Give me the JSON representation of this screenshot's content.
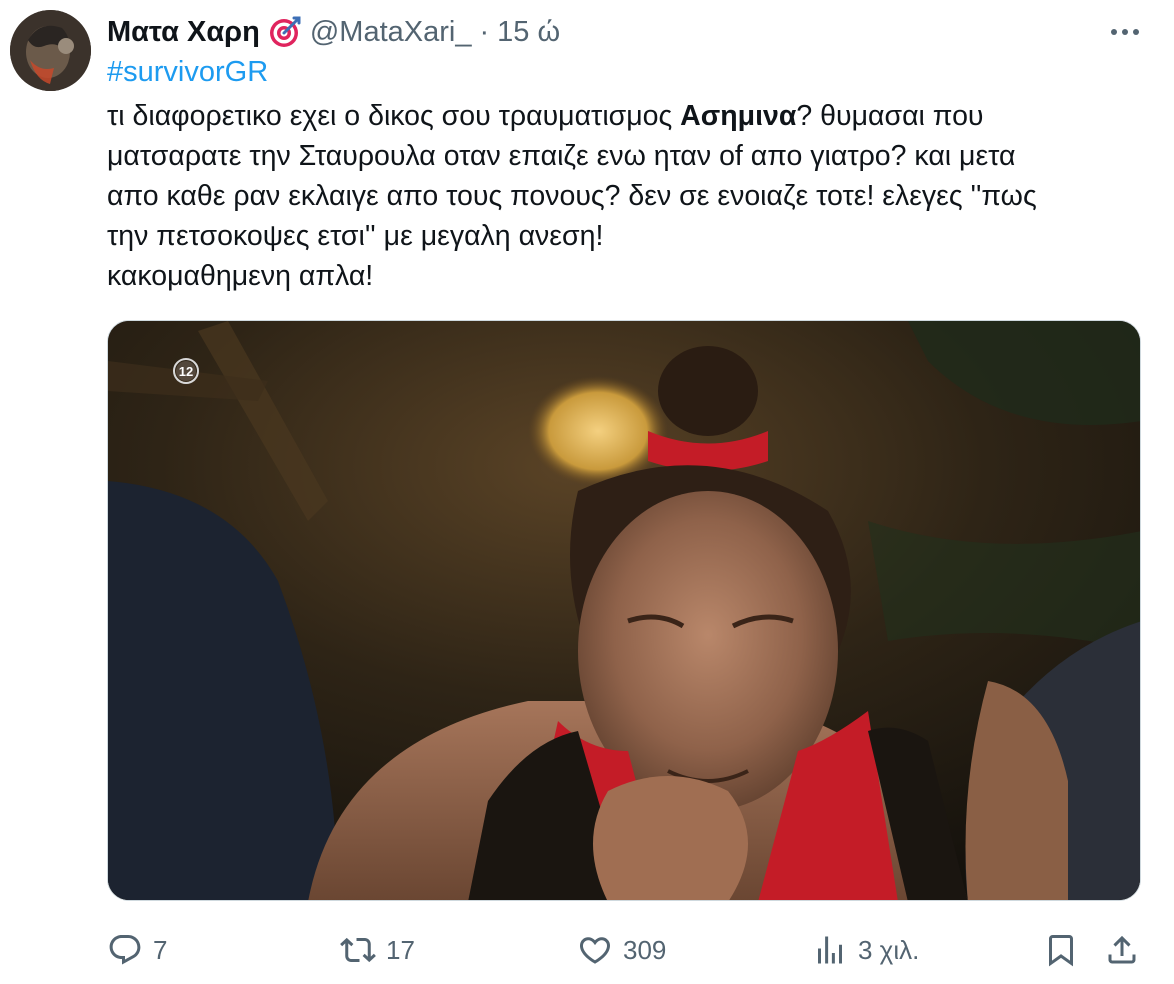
{
  "author": {
    "display_name": "Ματα Χαρη",
    "badge_icon": "target-icon",
    "handle": "@MataXari_",
    "separator": "·",
    "time": "15 ώ"
  },
  "hashtag": "#survivorGR",
  "text": {
    "line1_a": "τι διαφορετικο εχει ο δικος σου τραυματισμος ",
    "line1_bold": "Ασημινα",
    "line1_b": "? θυμασαι που",
    "line2": "ματσαρατε την Σταυρουλα οταν επαιζε ενω ηταν of απο γιατρο? και μετα",
    "line3": "απο καθε ραν εκλαιγε απο τους πονους? δεν σε ενοιαζε τοτε! ελεγες ''πως",
    "line4": "την πετσοκοψες ετσι'' με μεγαλη ανεση!",
    "line5": "κακομαθημενη απλα!"
  },
  "media": {
    "channel_logo": "12"
  },
  "actions": {
    "reply": {
      "icon": "reply-icon",
      "count": "7"
    },
    "retweet": {
      "icon": "retweet-icon",
      "count": "17"
    },
    "like": {
      "icon": "heart-icon",
      "count": "309"
    },
    "views": {
      "icon": "views-icon",
      "count": "3 χιλ."
    },
    "bookmark": {
      "icon": "bookmark-icon"
    },
    "share": {
      "icon": "share-icon"
    }
  },
  "colors": {
    "accent": "#1d9bf0",
    "secondary_text": "#536471",
    "primary_text": "#0f1419"
  }
}
